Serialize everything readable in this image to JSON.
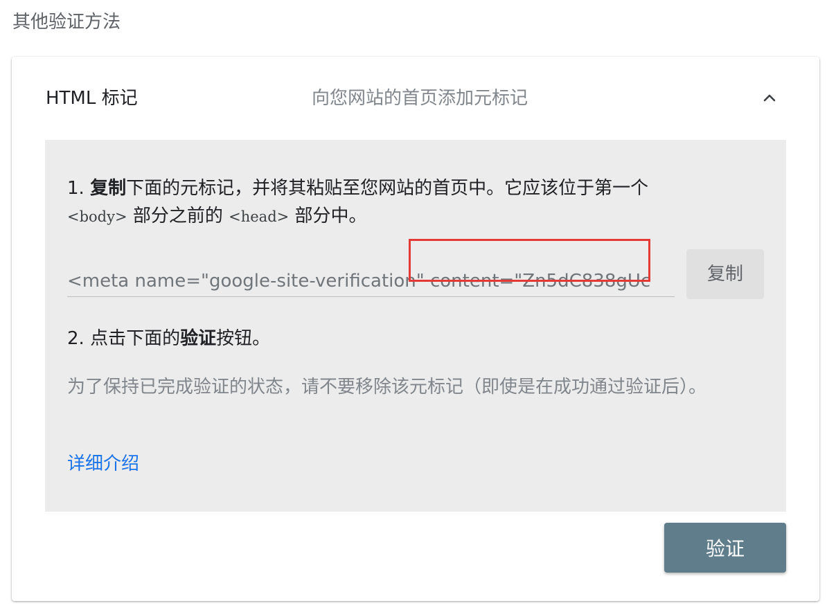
{
  "section_title": "其他验证方法",
  "method": {
    "name": "HTML 标记",
    "description": "向您网站的首页添加元标记",
    "expanded": true
  },
  "step1": {
    "prefix": "1. ",
    "bold": "复制",
    "text_a": "下面的元标记，并将其粘贴至您网站的首页中。它应该位于第一个 ",
    "tag_body": "<body>",
    "text_b": " 部分之前的 ",
    "tag_head": "<head>",
    "text_c": " 部分中。"
  },
  "meta_tag": {
    "value": "<meta name=\"google-site-verification\" content=\"Zn5dC838gUc"
  },
  "copy_button": {
    "label": "复制"
  },
  "step2": {
    "prefix": "2. 点击下面的",
    "bold": "验证",
    "suffix": "按钮。"
  },
  "note": "为了保持已完成验证的状态，请不要移除该元标记（即使是在成功通过验证后）。",
  "learn_more": "详细介绍",
  "verify_button": {
    "label": "验证"
  },
  "colors": {
    "accent_link": "#1a73e8",
    "verify_button": "#607d8b",
    "highlight": "#e53935",
    "panel_bg": "#ececec"
  },
  "icons": {
    "collapse": "chevron-up-icon"
  }
}
